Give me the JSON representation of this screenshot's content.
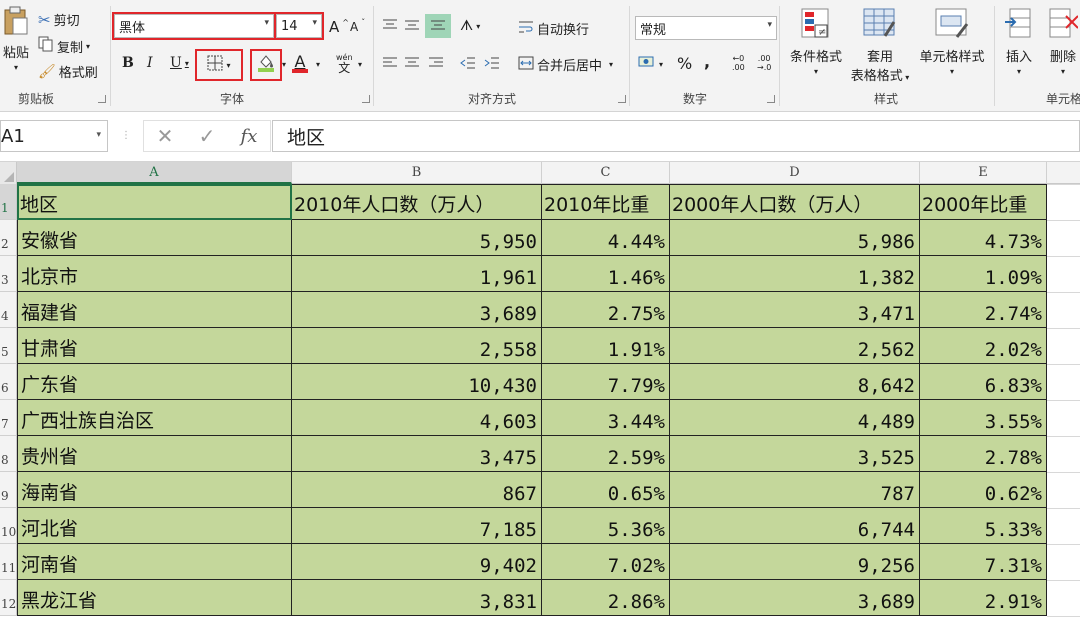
{
  "clipboard": {
    "paste": "粘贴",
    "cut": "剪切",
    "copy": "复制",
    "format_painter": "格式刷",
    "label": "剪贴板"
  },
  "font": {
    "name": "黑体",
    "size": "14",
    "grow": "A",
    "shrink": "A",
    "bold": "B",
    "italic": "I",
    "underline": "U",
    "font_color_glyph": "A",
    "phonetic_top": "wén",
    "phonetic_bottom": "文",
    "label": "字体"
  },
  "alignment": {
    "wrap_text": "自动换行",
    "merge_center": "合并后居中",
    "label": "对齐方式"
  },
  "number": {
    "format": "常规",
    "percent": "%",
    "comma": ",",
    "inc_top": "←0",
    "inc_bottom": ".00",
    "dec_top": ".00",
    "dec_bottom": "→.0",
    "label": "数字"
  },
  "styles": {
    "conditional": "条件格式",
    "table_line1": "套用",
    "table_line2": "表格格式",
    "cell_styles": "单元格样式",
    "label": "样式"
  },
  "cells": {
    "insert": "插入",
    "delete": "删除",
    "label": "单元格"
  },
  "formula_bar": {
    "name_box": "A1",
    "cancel": "✕",
    "enter": "✓",
    "fx": "fx",
    "content": "地区"
  },
  "columns": [
    "A",
    "B",
    "C",
    "D",
    "E"
  ],
  "row_numbers": [
    "1",
    "2",
    "3",
    "4",
    "5",
    "6",
    "7",
    "8",
    "9",
    "10",
    "11",
    "12"
  ],
  "header": [
    "地区",
    "2010年人口数（万人）",
    "2010年比重",
    "2000年人口数（万人）",
    "2000年比重"
  ],
  "rows": [
    [
      "安徽省",
      "5,950",
      "4.44%",
      "5,986",
      "4.73%"
    ],
    [
      "北京市",
      "1,961",
      "1.46%",
      "1,382",
      "1.09%"
    ],
    [
      "福建省",
      "3,689",
      "2.75%",
      "3,471",
      "2.74%"
    ],
    [
      "甘肃省",
      "2,558",
      "1.91%",
      "2,562",
      "2.02%"
    ],
    [
      "广东省",
      "10,430",
      "7.79%",
      "8,642",
      "6.83%"
    ],
    [
      "广西壮族自治区",
      "4,603",
      "3.44%",
      "4,489",
      "3.55%"
    ],
    [
      "贵州省",
      "3,475",
      "2.59%",
      "3,525",
      "2.78%"
    ],
    [
      "海南省",
      "867",
      "0.65%",
      "787",
      "0.62%"
    ],
    [
      "河北省",
      "7,185",
      "5.36%",
      "6,744",
      "5.33%"
    ],
    [
      "河南省",
      "9,402",
      "7.02%",
      "9,256",
      "7.31%"
    ],
    [
      "黑龙江省",
      "3,831",
      "2.86%",
      "3,689",
      "2.91%"
    ]
  ],
  "colors": {
    "cell_fill": "#c4d79b",
    "highlight_box": "#e0262b",
    "selection": "#217346"
  }
}
